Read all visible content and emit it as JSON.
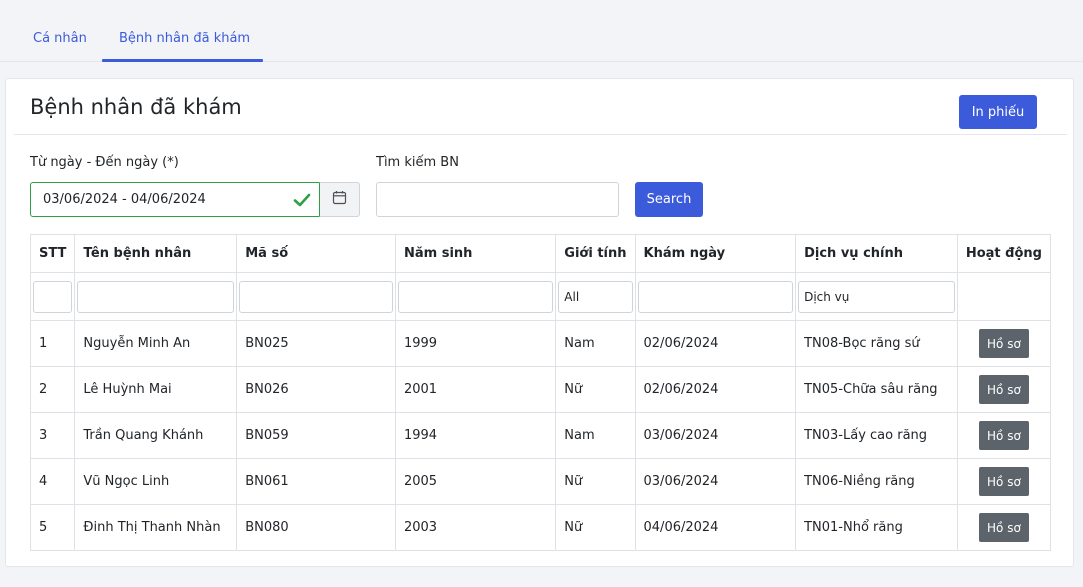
{
  "tabs": [
    {
      "label": "Cá nhân"
    },
    {
      "label": "Bệnh nhân đã khám"
    }
  ],
  "card": {
    "title": "Bệnh nhân đã khám",
    "print_label": "In phiếu"
  },
  "filters": {
    "date_label": "Từ ngày - Đến ngày (*)",
    "date_value": "03/06/2024 - 04/06/2024",
    "search_label": "Tìm kiếm BN",
    "search_value": "",
    "search_button": "Search"
  },
  "table": {
    "headers": [
      "STT",
      "Tên bệnh nhân",
      "Mã số",
      "Năm sinh",
      "Giới tính",
      "Khám ngày",
      "Dịch vụ chính",
      "Hoạt động"
    ],
    "filter_placeholders": {
      "gender": "All",
      "service": "Dịch vụ"
    },
    "action_label": "Hồ sơ",
    "rows": [
      {
        "stt": "1",
        "name": "Nguyễn Minh An",
        "code": "BN025",
        "birth_year": "1999",
        "gender": "Nam",
        "date": "02/06/2024",
        "service": "TN08-Bọc răng sứ"
      },
      {
        "stt": "2",
        "name": "Lê Huỳnh Mai",
        "code": "BN026",
        "birth_year": "2001",
        "gender": "Nữ",
        "date": "02/06/2024",
        "service": "TN05-Chữa sâu răng"
      },
      {
        "stt": "3",
        "name": "Trần Quang Khánh",
        "code": "BN059",
        "birth_year": "1994",
        "gender": "Nam",
        "date": "03/06/2024",
        "service": "TN03-Lấy cao răng"
      },
      {
        "stt": "4",
        "name": "Vũ Ngọc Linh",
        "code": "BN061",
        "birth_year": "2005",
        "gender": "Nữ",
        "date": "03/06/2024",
        "service": "TN06-Niềng răng"
      },
      {
        "stt": "5",
        "name": "Đinh Thị Thanh Nhàn",
        "code": "BN080",
        "birth_year": "2003",
        "gender": "Nữ",
        "date": "04/06/2024",
        "service": "TN01-Nhổ răng"
      }
    ]
  },
  "colors": {
    "primary": "#3b5bdb",
    "valid": "#2f9e44",
    "secondary": "#5c636a"
  }
}
